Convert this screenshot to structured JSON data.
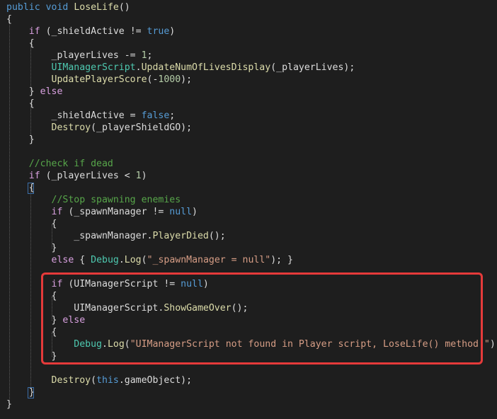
{
  "code": {
    "l1": {
      "kw1": "public",
      "kw2": "void",
      "fn": "LoseLife",
      "rest": "()"
    },
    "l2": {
      "text": "{"
    },
    "l3": {
      "kw": "if",
      "a": " (_shieldActive != ",
      "val": "true",
      "b": ")"
    },
    "l4": {
      "text": "{"
    },
    "l5": {
      "a": "_playerLives -= ",
      "num": "1",
      "b": ";"
    },
    "l6": {
      "ty": "UIManagerScript",
      "dot": ".",
      "fn": "UpdateNumOfLivesDisplay",
      "rest": "(_playerLives);"
    },
    "l7": {
      "fn": "UpdatePlayerScore",
      "a": "(-",
      "num": "1000",
      "b": ");"
    },
    "l8": {
      "a": "} ",
      "kw": "else"
    },
    "l9": {
      "text": "{"
    },
    "l10": {
      "a": "_shieldActive = ",
      "val": "false",
      "b": ";"
    },
    "l11": {
      "fn": "Destroy",
      "rest": "(_playerShieldGO);"
    },
    "l12": {
      "text": "}"
    },
    "l13": {
      "text": "//check if dead"
    },
    "l14": {
      "kw": "if",
      "a": " (_playerLives < ",
      "num": "1",
      "b": ")"
    },
    "l15": {
      "text": "{"
    },
    "l16": {
      "text": "//Stop spawning enemies"
    },
    "l17": {
      "kw": "if",
      "a": " (_spawnManager != ",
      "val": "null",
      "b": ")"
    },
    "l18": {
      "text": "{"
    },
    "l19": {
      "a": "_spawnManager.",
      "fn": "PlayerDied",
      "b": "();"
    },
    "l20": {
      "text": "}"
    },
    "l21": {
      "kw": "else",
      "a": " { ",
      "ty": "Debug",
      "dot": ".",
      "fn": "Log",
      "b": "(",
      "str": "\"_spawnManager = null\"",
      "c": "); }"
    },
    "l22": {
      "kw": "if",
      "a": " (UIManagerScript != ",
      "val": "null",
      "b": ")"
    },
    "l23": {
      "text": "{"
    },
    "l24": {
      "a": "UIManagerScript.",
      "fn": "ShowGameOver",
      "b": "();"
    },
    "l25": {
      "a": "} ",
      "kw": "else"
    },
    "l26": {
      "text": "{"
    },
    "l27": {
      "ty": "Debug",
      "dot": ".",
      "fn": "Log",
      "b": "(",
      "str": "\"UIManagerScript not found in Player script, LoseLife() method!\"",
      "c": ");"
    },
    "l28": {
      "text": "}"
    },
    "l29": {
      "fn": "Destroy",
      "a": "(",
      "kw": "this",
      "b": ".gameObject);"
    },
    "l30": {
      "text": "}"
    },
    "l31": {
      "text": "}"
    }
  },
  "colors": {
    "background": "#1e1e1e",
    "keyword": "#569cd6",
    "control": "#d8a0df",
    "method": "#dcdcaa",
    "type": "#4ec9b0",
    "comment": "#57a64a",
    "string": "#d69d85",
    "number": "#b5cea8",
    "highlight": "#e53a3a"
  }
}
